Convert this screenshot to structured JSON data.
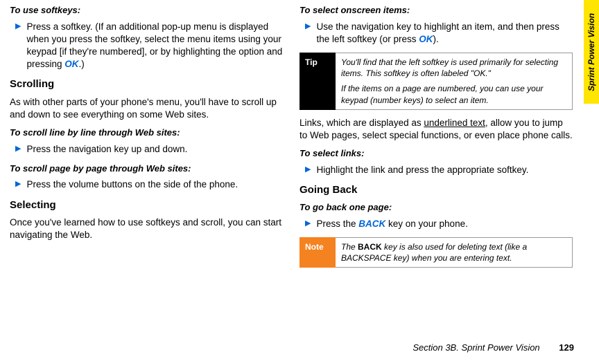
{
  "sideTab": "Sprint Power Vision",
  "colLeft": {
    "softkeysHeading": "To use softkeys:",
    "softkeysBullet_a": "Press a softkey. (If an additional pop-up menu is displayed when you press the softkey, select the menu items using your keypad [if they're numbered], or by highlighting the option and pressing ",
    "softkeysBullet_b": ".)",
    "ok": "OK",
    "scrollingH": "Scrolling",
    "scrollingP": "As with other parts of your phone's menu, you'll have to scroll up and down to see everything on some Web sites.",
    "scrollLineH": "To scroll line by line through Web sites:",
    "scrollLineBullet": "Press the navigation key up and down.",
    "scrollPageH": "To scroll page by page through Web sites:",
    "scrollPageBullet": "Press the volume buttons on the side of the phone.",
    "selectingH": "Selecting",
    "selectingP": "Once you've learned how to use softkeys and scroll, you can start navigating the Web."
  },
  "colRight": {
    "selectOnH": "To select onscreen items:",
    "selectOnBullet_a": "Use the navigation key to highlight an item, and then press the left softkey (or press ",
    "selectOnBullet_b": ").",
    "ok": "OK",
    "tipLabel": "Tip",
    "tipP1": "You'll find that the left softkey is used primarily for selecting items. This softkey is often labeled \"OK.\"",
    "tipP2": "If the items on a page are numbered, you can use your keypad (number keys) to select an item.",
    "linksP_a": "Links, which are displayed as ",
    "linksP_ul": "underlined text",
    "linksP_b": ", allow you to jump to Web pages, select special functions, or even place phone calls.",
    "selectLinksH": "To select links:",
    "selectLinksBullet": "Highlight the link and press the appropriate softkey.",
    "goingBackH": "Going Back",
    "goBackH": "To go back one page:",
    "goBackBullet_a": "Press the ",
    "goBackBullet_b": " key on your phone.",
    "back": "BACK",
    "noteLabel": "Note",
    "noteP_a": "The ",
    "noteP_bold": "BACK",
    "noteP_b": " key is also used for deleting text (like a BACKSPACE key) when you are entering text."
  },
  "footer": {
    "section": "Section 3B. Sprint Power Vision",
    "page": "129"
  }
}
